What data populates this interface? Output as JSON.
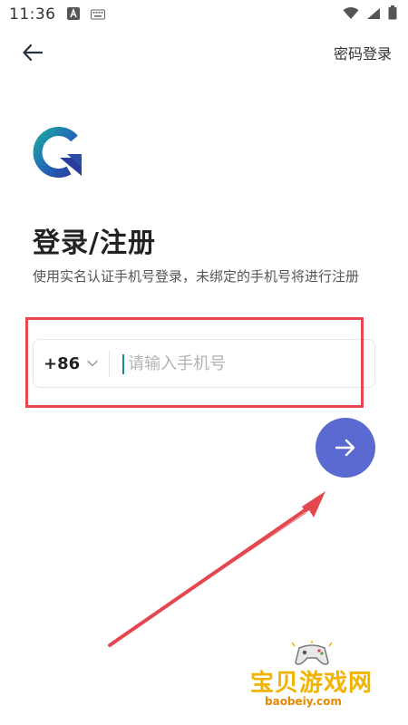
{
  "status_bar": {
    "time": "11:36"
  },
  "nav": {
    "password_login": "密码登录"
  },
  "main": {
    "title": "登录/注册",
    "subtitle": "使用实名认证手机号登录，未绑定的手机号将进行注册"
  },
  "phone_form": {
    "country_code": "+86",
    "phone_placeholder": "请输入手机号",
    "phone_value": ""
  },
  "watermark": {
    "title": "宝贝游戏网",
    "url": "baobeiy.com"
  },
  "colors": {
    "accent": "#5a6ad0",
    "highlight_border": "#e5474f",
    "logo_green": "#1aa6a0",
    "logo_blue": "#2a3c9c"
  }
}
